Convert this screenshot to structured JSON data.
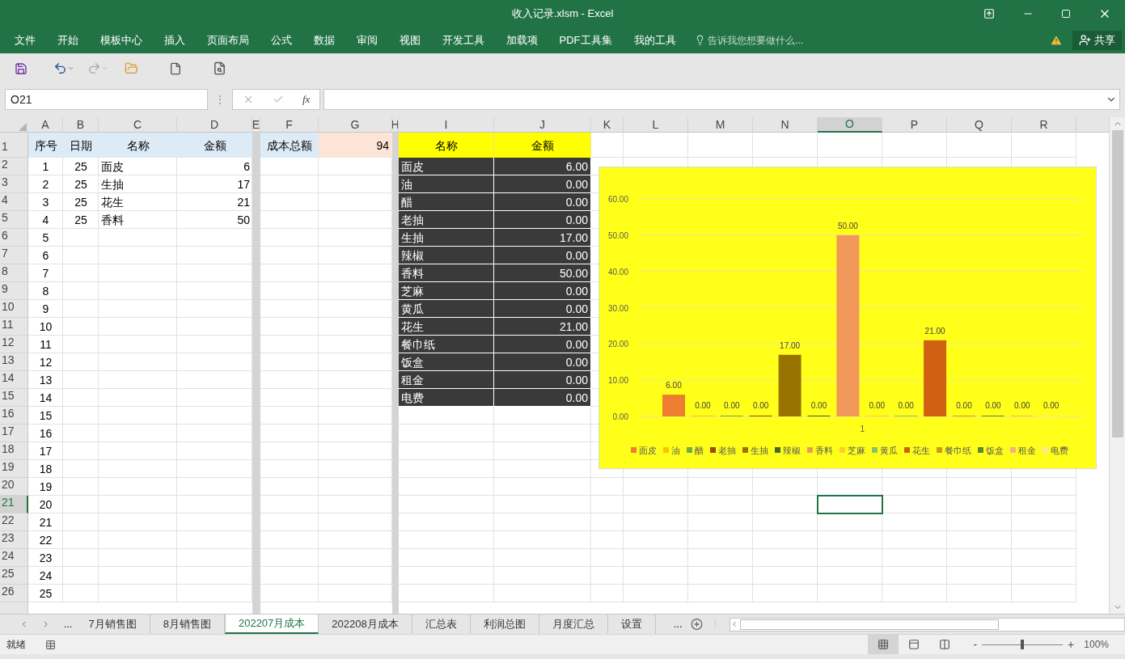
{
  "window": {
    "title": "收入记录.xlsm - Excel"
  },
  "ribbon_tabs": [
    {
      "label": "文件"
    },
    {
      "label": "开始"
    },
    {
      "label": "模板中心"
    },
    {
      "label": "插入"
    },
    {
      "label": "页面布局"
    },
    {
      "label": "公式"
    },
    {
      "label": "数据"
    },
    {
      "label": "审阅"
    },
    {
      "label": "视图"
    },
    {
      "label": "开发工具"
    },
    {
      "label": "加载项"
    },
    {
      "label": "PDF工具集"
    },
    {
      "label": "我的工具"
    }
  ],
  "tell_me": {
    "placeholder": "告诉我您想要做什么..."
  },
  "share": "共享",
  "name_box": "O21",
  "formula_bar": {
    "splitter": "⋮",
    "fx": "fx"
  },
  "column_headers": [
    {
      "label": "A",
      "selected": false
    },
    {
      "label": "B",
      "selected": false
    },
    {
      "label": "C",
      "selected": false
    },
    {
      "label": "D",
      "selected": false
    },
    {
      "label": "E",
      "selected": false
    },
    {
      "label": "F",
      "selected": false
    },
    {
      "label": "G",
      "selected": false
    },
    {
      "label": "H",
      "selected": false
    },
    {
      "label": "I",
      "selected": false
    },
    {
      "label": "J",
      "selected": false
    },
    {
      "label": "K",
      "selected": false
    },
    {
      "label": "L",
      "selected": false
    },
    {
      "label": "M",
      "selected": false
    },
    {
      "label": "N",
      "selected": false
    },
    {
      "label": "O",
      "selected": true
    },
    {
      "label": "P",
      "selected": false
    },
    {
      "label": "Q",
      "selected": false
    },
    {
      "label": "R",
      "selected": false
    }
  ],
  "row_headers": [
    {
      "label": "1",
      "selected": false
    },
    {
      "label": "2",
      "selected": false
    },
    {
      "label": "3",
      "selected": false
    },
    {
      "label": "4",
      "selected": false
    },
    {
      "label": "5",
      "selected": false
    },
    {
      "label": "6",
      "selected": false
    },
    {
      "label": "7",
      "selected": false
    },
    {
      "label": "8",
      "selected": false
    },
    {
      "label": "9",
      "selected": false
    },
    {
      "label": "10",
      "selected": false
    },
    {
      "label": "11",
      "selected": false
    },
    {
      "label": "12",
      "selected": false
    },
    {
      "label": "13",
      "selected": false
    },
    {
      "label": "14",
      "selected": false
    },
    {
      "label": "15",
      "selected": false
    },
    {
      "label": "16",
      "selected": false
    },
    {
      "label": "17",
      "selected": false
    },
    {
      "label": "18",
      "selected": false
    },
    {
      "label": "19",
      "selected": false
    },
    {
      "label": "20",
      "selected": false
    },
    {
      "label": "21",
      "selected": true
    },
    {
      "label": "22",
      "selected": false
    },
    {
      "label": "23",
      "selected": false
    },
    {
      "label": "24",
      "selected": false
    },
    {
      "label": "25",
      "selected": false
    },
    {
      "label": "26",
      "selected": false
    }
  ],
  "records": {
    "columns": [
      "序号",
      "日期",
      "名称",
      "金额"
    ],
    "rows": [
      {
        "no": "1",
        "day": "25",
        "name": "面皮",
        "amount": "6"
      },
      {
        "no": "2",
        "day": "25",
        "name": "生抽",
        "amount": "17"
      },
      {
        "no": "3",
        "day": "25",
        "name": "花生",
        "amount": "21"
      },
      {
        "no": "4",
        "day": "25",
        "name": "香料",
        "amount": "50"
      },
      {
        "no": "5"
      },
      {
        "no": "6"
      },
      {
        "no": "7"
      },
      {
        "no": "8"
      },
      {
        "no": "9"
      },
      {
        "no": "10"
      },
      {
        "no": "11"
      },
      {
        "no": "12"
      },
      {
        "no": "13"
      },
      {
        "no": "14"
      },
      {
        "no": "15"
      },
      {
        "no": "16"
      },
      {
        "no": "17"
      },
      {
        "no": "18"
      },
      {
        "no": "19"
      },
      {
        "no": "20"
      },
      {
        "no": "21"
      },
      {
        "no": "22"
      },
      {
        "no": "23"
      },
      {
        "no": "24"
      },
      {
        "no": "25"
      }
    ]
  },
  "summary": {
    "label": "成本总额",
    "value": "94"
  },
  "costs": {
    "columns": [
      "名称",
      "金额"
    ],
    "rows": [
      {
        "name": "面皮",
        "amount": "6.00"
      },
      {
        "name": "油",
        "amount": "0.00"
      },
      {
        "name": "醋",
        "amount": "0.00"
      },
      {
        "name": "老抽",
        "amount": "0.00"
      },
      {
        "name": "生抽",
        "amount": "17.00"
      },
      {
        "name": "辣椒",
        "amount": "0.00"
      },
      {
        "name": "香料",
        "amount": "50.00"
      },
      {
        "name": "芝麻",
        "amount": "0.00"
      },
      {
        "name": "黄瓜",
        "amount": "0.00"
      },
      {
        "name": "花生",
        "amount": "21.00"
      },
      {
        "name": "餐巾纸",
        "amount": "0.00"
      },
      {
        "name": "饭盒",
        "amount": "0.00"
      },
      {
        "name": "租金",
        "amount": "0.00"
      },
      {
        "name": "电费",
        "amount": "0.00"
      }
    ]
  },
  "chart": {
    "chart_data": {
      "type": "bar",
      "categories": [
        "1"
      ],
      "ylim": [
        0,
        60
      ],
      "yticks": [
        {
          "value": 0,
          "label": "0.00"
        },
        {
          "value": 10,
          "label": "10.00"
        },
        {
          "value": 20,
          "label": "20.00"
        },
        {
          "value": 30,
          "label": "30.00"
        },
        {
          "value": 40,
          "label": "40.00"
        },
        {
          "value": 50,
          "label": "50.00"
        },
        {
          "value": 60,
          "label": "60.00"
        }
      ],
      "grid": true,
      "legend": true,
      "series": [
        {
          "name": "面皮",
          "color": "#ed7d31",
          "values": [
            6
          ],
          "value_labels": [
            "6.00"
          ]
        },
        {
          "name": "油",
          "color": "#ffc000",
          "values": [
            0
          ],
          "value_labels": [
            "0.00"
          ]
        },
        {
          "name": "醋",
          "color": "#70ad47",
          "values": [
            0
          ],
          "value_labels": [
            "0.00"
          ]
        },
        {
          "name": "老抽",
          "color": "#9e480e",
          "values": [
            0
          ],
          "value_labels": [
            "0.00"
          ]
        },
        {
          "name": "生抽",
          "color": "#997300",
          "values": [
            17
          ],
          "value_labels": [
            "17.00"
          ]
        },
        {
          "name": "辣椒",
          "color": "#43682b",
          "values": [
            0
          ],
          "value_labels": [
            "0.00"
          ]
        },
        {
          "name": "香料",
          "color": "#f1975a",
          "values": [
            50
          ],
          "value_labels": [
            "50.00"
          ]
        },
        {
          "name": "芝麻",
          "color": "#ffcd33",
          "values": [
            0
          ],
          "value_labels": [
            "0.00"
          ]
        },
        {
          "name": "黄瓜",
          "color": "#8cc168",
          "values": [
            0
          ],
          "value_labels": [
            "0.00"
          ]
        },
        {
          "name": "花生",
          "color": "#d26012",
          "values": [
            21
          ],
          "value_labels": [
            "21.00"
          ]
        },
        {
          "name": "餐巾纸",
          "color": "#cc9a1a",
          "values": [
            0
          ],
          "value_labels": [
            "0.00"
          ]
        },
        {
          "name": "饭盒",
          "color": "#5a8a32",
          "values": [
            0
          ],
          "value_labels": [
            "0.00"
          ]
        },
        {
          "name": "租金",
          "color": "#f4b183",
          "values": [
            0
          ],
          "value_labels": [
            "0.00"
          ]
        },
        {
          "name": "电费",
          "color": "#ffe699",
          "values": [
            0
          ],
          "value_labels": [
            "0.00"
          ]
        }
      ]
    }
  },
  "sheet_tabs": [
    {
      "label": "7月销售图",
      "selected": false
    },
    {
      "label": "8月销售图",
      "selected": false
    },
    {
      "label": "202207月成本",
      "selected": true
    },
    {
      "label": "202208月成本",
      "selected": false
    },
    {
      "label": "汇总表",
      "selected": false
    },
    {
      "label": "利润总图",
      "selected": false
    },
    {
      "label": "月度汇总",
      "selected": false
    },
    {
      "label": "设置",
      "selected": false
    }
  ],
  "tab_nav": {
    "more_left": "...",
    "more_right": "...",
    "splitter": "⋮"
  },
  "status_bar": {
    "status": "就绪",
    "views": [
      {
        "kind": "normal",
        "selected": true
      },
      {
        "kind": "layout",
        "selected": false
      },
      {
        "kind": "pagebreak",
        "selected": false
      }
    ],
    "zoom": {
      "minus": "-",
      "plus": "+",
      "level": 0.5,
      "reading": "100%"
    }
  }
}
